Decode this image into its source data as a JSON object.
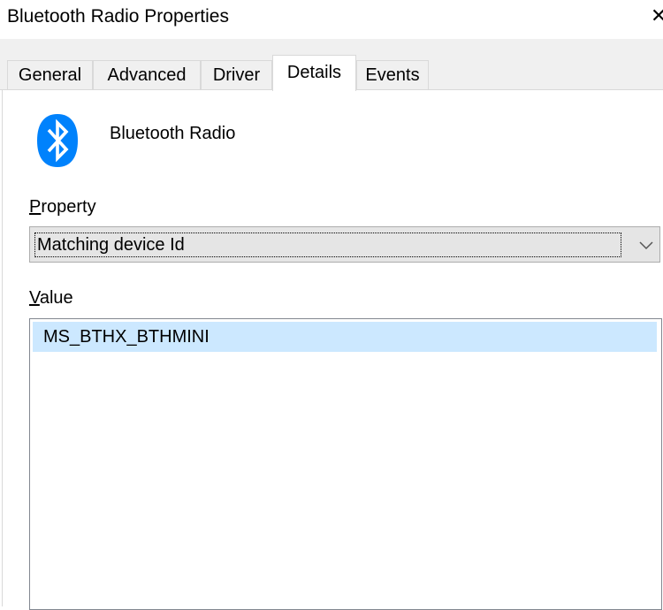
{
  "window": {
    "title": "Bluetooth Radio Properties"
  },
  "tabs": [
    {
      "label": "General",
      "active": false
    },
    {
      "label": "Advanced",
      "active": false
    },
    {
      "label": "Driver",
      "active": false
    },
    {
      "label": "Details",
      "active": true
    },
    {
      "label": "Events",
      "active": false
    }
  ],
  "device": {
    "name": "Bluetooth Radio",
    "icon": "bluetooth-icon"
  },
  "property": {
    "label_first": "P",
    "label_rest": "roperty",
    "selected": "Matching device Id"
  },
  "value": {
    "label_first": "V",
    "label_rest": "alue",
    "items": [
      "MS_BTHX_BTHMINI"
    ]
  },
  "colors": {
    "bluetooth_blue": "#0082fc",
    "selection": "#cce8ff",
    "tab_bg": "#f0f0f0"
  }
}
